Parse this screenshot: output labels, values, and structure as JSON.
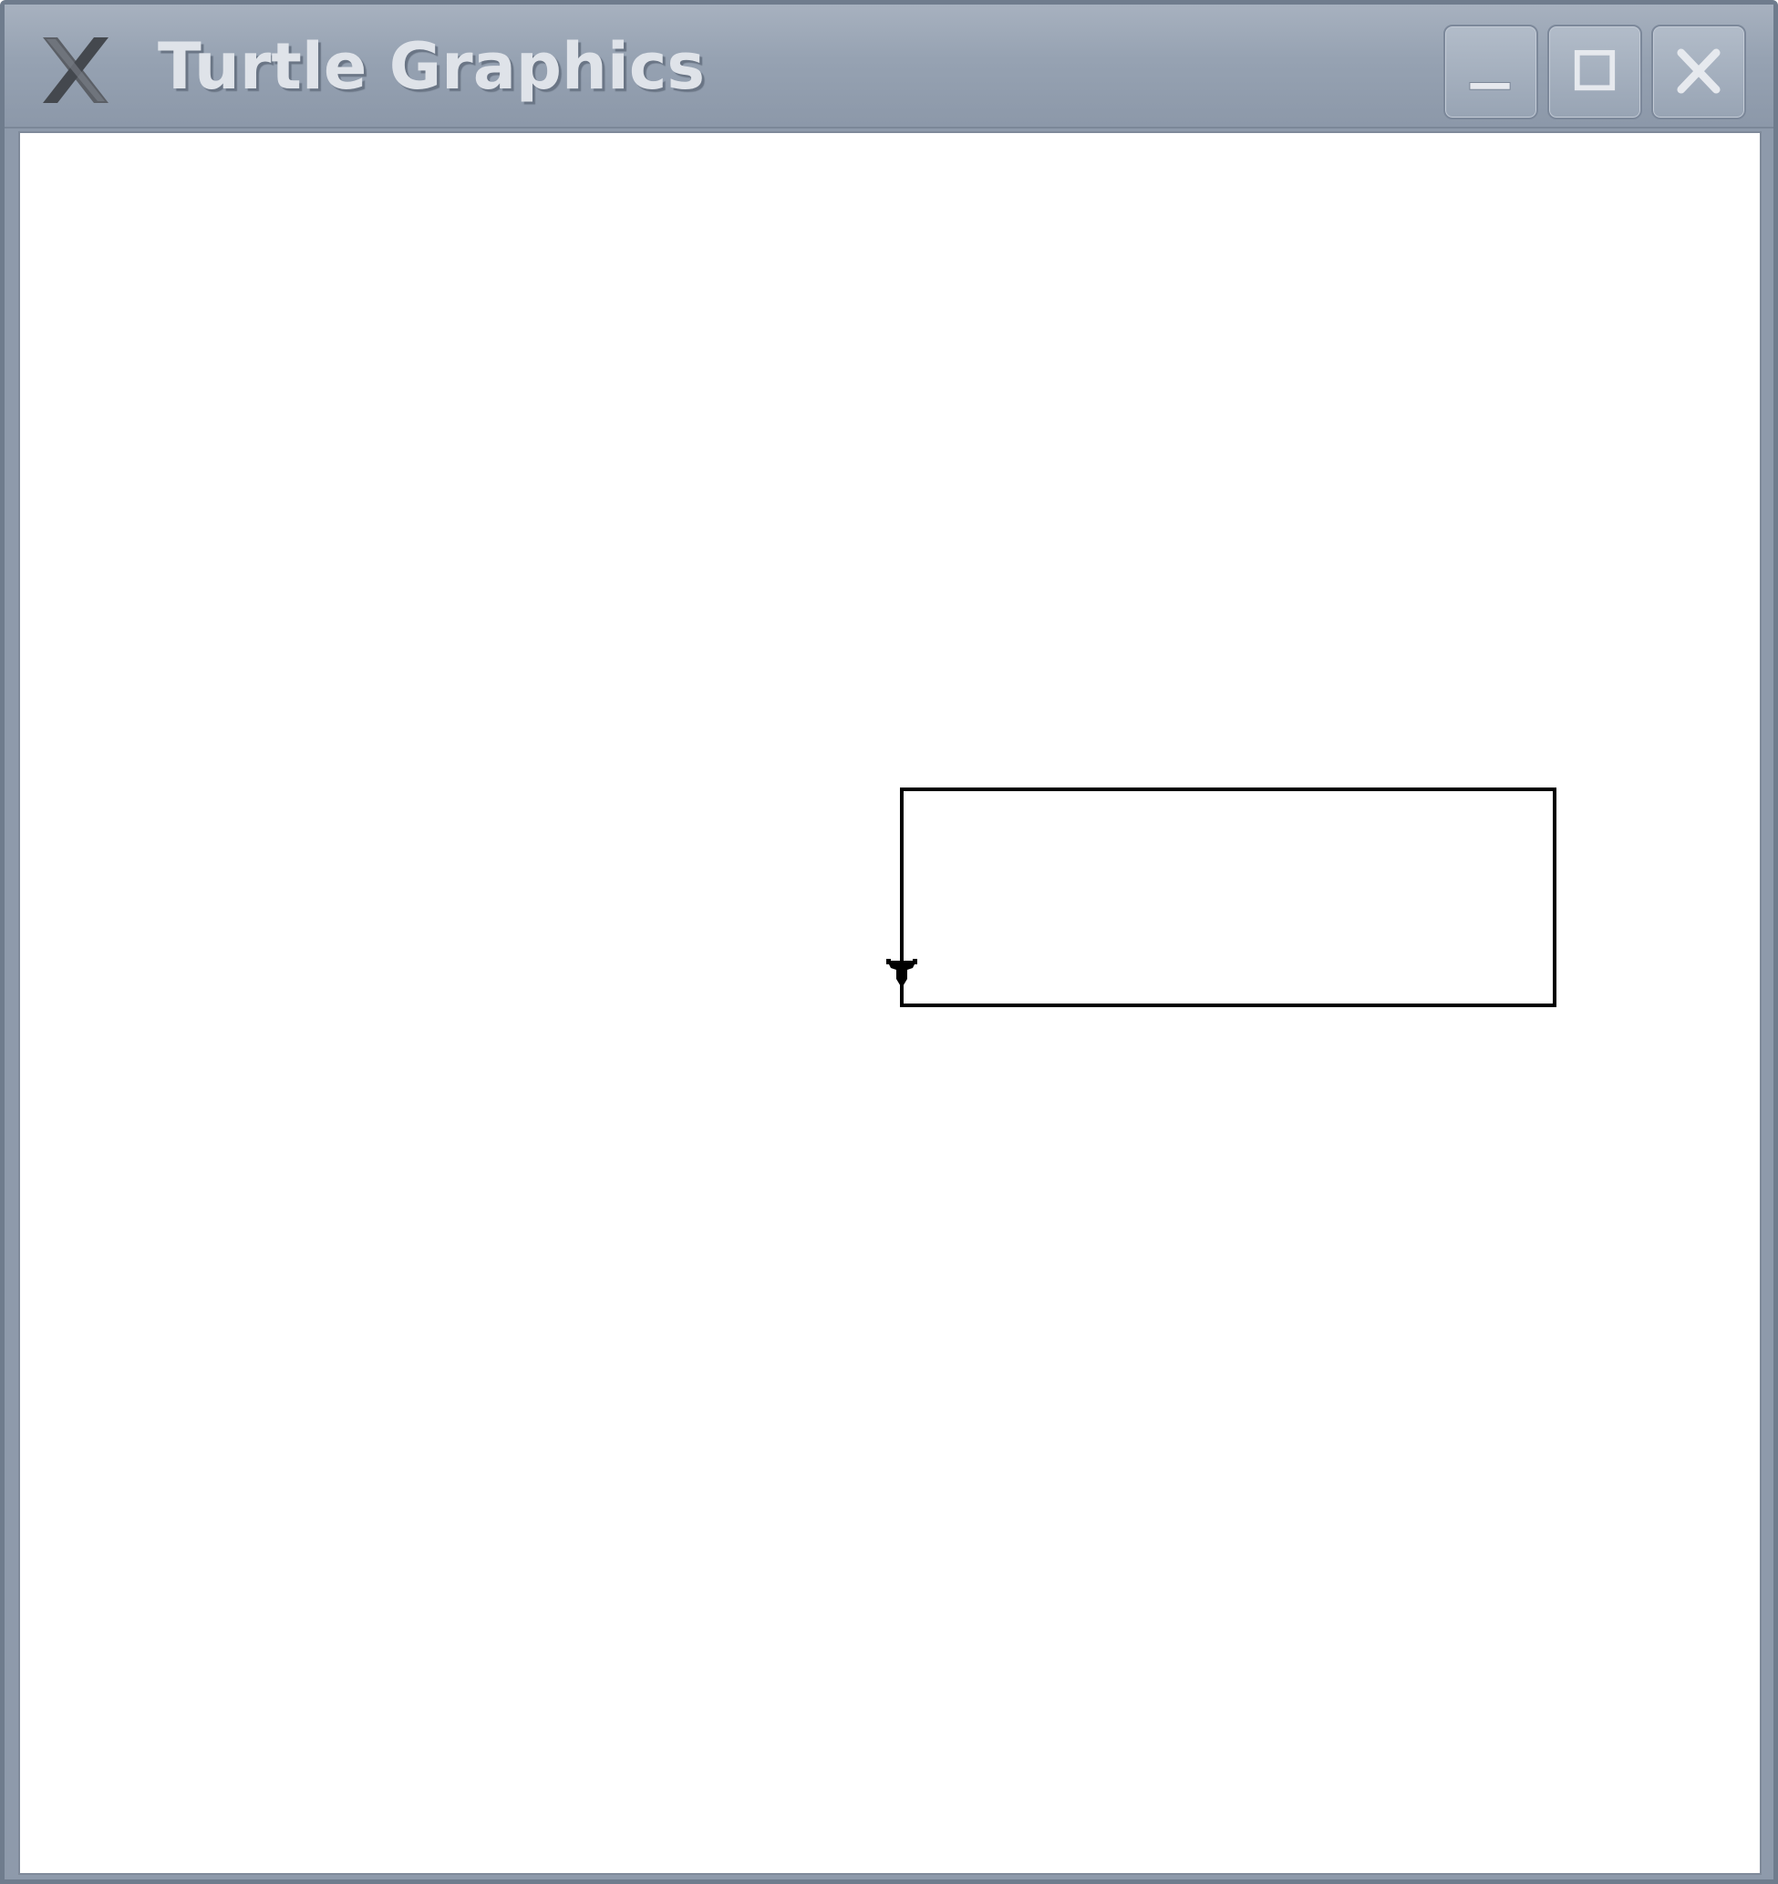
{
  "window": {
    "title": "Turtle Graphics",
    "icon": "x-logo-icon",
    "controls": [
      {
        "name": "minimize-button",
        "icon": "minimize-icon"
      },
      {
        "name": "maximize-button",
        "icon": "maximize-icon"
      },
      {
        "name": "close-button",
        "icon": "close-icon"
      }
    ]
  },
  "canvas": {
    "background": "#ffffff",
    "pen_color": "#000000",
    "turtle_heading": "down"
  },
  "colors": {
    "titlebar": "#97a3b3",
    "title_text": "#dfe3e9"
  }
}
